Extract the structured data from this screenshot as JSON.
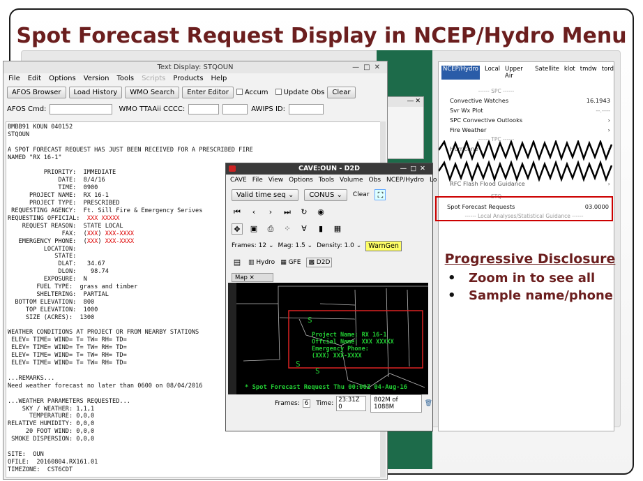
{
  "slide": {
    "title": "Spot Forecast Request Display in NCEP/Hydro Menu"
  },
  "text_window": {
    "title": "Text Display: STQOUN",
    "menu": [
      "File",
      "Edit",
      "Options",
      "Version",
      "Tools",
      "Scripts",
      "Products",
      "Help"
    ],
    "toolbar": {
      "afos_browser": "AFOS Browser",
      "load_history": "Load History",
      "wmo_search": "WMO Search",
      "enter_editor": "Enter Editor",
      "accum": "Accum",
      "update_obs": "Update Obs",
      "clear": "Clear"
    },
    "fields": {
      "afos_cmd": "AFOS Cmd:",
      "wmo_ttaaii": "WMO TTAAii CCCC:",
      "awips_id": "AWIPS ID:"
    },
    "body": "BMBB91 KOUN 040152\nSTQOUN\n\nA SPOT FORECAST REQUEST HAS JUST BEEN RECEIVED FOR A PRESCRIBED FIRE\nNAMED \"RX 16-1\"\n\n          PRIORITY:  IMMEDIATE\n              DATE:  8/4/16\n              TIME:  0900\n      PROJECT NAME:  RX 16-1\n      PROJECT TYPE:  PRESCRIBED\n REQUESTING AGENCY:  Ft. Sill Fire & Emergency Serives\nREQUESTING OFFICIAL:  XXX XXXXX\n    REQUEST REASON:  STATE LOCAL\n               FAX:  (XXX) XXX-XXXX\n   EMERGENCY PHONE:  (XXX) XXX-XXXX\n          LOCATION:\n             STATE:\n              DLAT:   34.67\n              DLON:    98.74\n          EXPOSURE:  N\n        FUEL TYPE:  grass and timber\n        SHELTERING:  PARTIAL\n  BOTTOM ELEVATION:  800\n     TOP ELEVATION:  1000\n     SIZE (ACRES):  1300\n\nWEATHER CONDITIONS AT PROJECT OR FROM NEARBY STATIONS\n ELEV= TIME= WIND= T= TW= RH= TD=\n ELEV= TIME= WIND= T= TW= RH= TD=\n ELEV= TIME= WIND= T= TW= RH= TD=\n ELEV= TIME= WIND= T= TW= RH= TD=\n\n...REMARKS...\nNeed weather forecast no later than 0600 on 08/04/2016\n\n...WEATHER PARAMETERS REQUESTED...\n    SKY / WEATHER: 1,1,1\n      TEMPERATURE: 0,0,0\nRELATIVE HUMIDITY: 0,0,0\n     20 FOOT WIND: 0,0,0\n SMOKE DISPERSION: 0,0,0\n\nSITE:  OUN\nOFILE:  20160804.RX161.01\nTIMEZONE:  CST6CDT"
  },
  "cave": {
    "title": "CAVE:OUN - D2D",
    "menu": [
      "CAVE",
      "File",
      "View",
      "Options",
      "Tools",
      "Volume",
      "Obs",
      "NCEP/Hydro",
      "Lo"
    ],
    "valid_time": "Valid time seq",
    "scale": "CONUS",
    "clear": "Clear",
    "frames": "Frames: 12",
    "mag": "Mag: 1.5",
    "density": "Density: 1.0",
    "warngen": "WarnGen",
    "perspectives": [
      "Hydro",
      "GFE",
      "D2D"
    ],
    "map_tab": "Map",
    "map_lines": [
      "Project Name: RX 16-1",
      "Offcial Name: XXX XXXXX",
      "Emergency Phone:",
      "(XXX) XXX-XXXX"
    ],
    "map_footer": "* Spot Forecast Request  Thu 00:00Z 04-Aug-16",
    "status": {
      "frames_label": "Frames:",
      "frames_val": "6",
      "time_label": "Time:",
      "time_val": "23:31Z 0",
      "memory": "802M of 1088M"
    }
  },
  "ncep": {
    "menu": [
      "NCEP/Hydro",
      "Local",
      "Upper Air",
      "Satellite",
      "klot",
      "tmdw",
      "tord"
    ],
    "spc_sep": "------ SPC ------",
    "items_spc": [
      {
        "label": "Convective Watches",
        "value": "16.1943"
      },
      {
        "label": "Svr Wx Plot",
        "value": "--.----"
      },
      {
        "label": "SPC Convective Outlooks",
        "value": "›"
      },
      {
        "label": "Fire Weather",
        "value": "›"
      }
    ],
    "tpc_sep": "------ TPC ------",
    "hurricane": "Hurricane",
    "rfc": "RFC Flash Flood Guidance",
    "stq_sep": "------ STQ ------",
    "spot": {
      "label": "Spot Forecast Requests",
      "value": "03.0000"
    },
    "local_sep": "------ Local Analyses/Statistical Guidance ------"
  },
  "notes": {
    "heading": "Progressive Disclosure",
    "bullets": [
      "Zoom in to see all",
      "Sample name/phone"
    ]
  }
}
